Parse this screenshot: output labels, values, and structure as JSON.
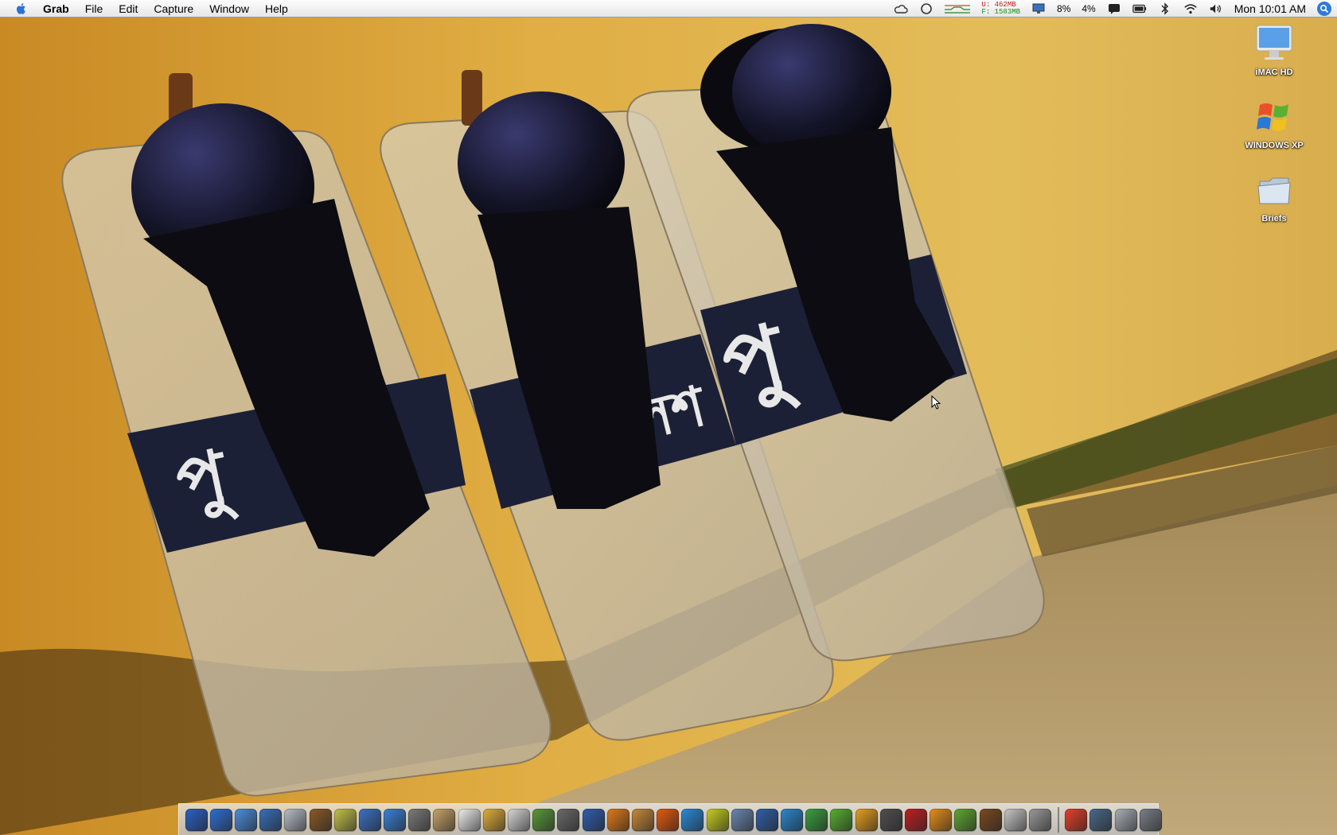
{
  "menubar": {
    "app_name": "Grab",
    "menus": [
      "File",
      "Edit",
      "Capture",
      "Window",
      "Help"
    ],
    "status": {
      "memory_used": "U: 462MB",
      "memory_free": "F: 1583MB",
      "cpu_percent_1": "8%",
      "cpu_percent_2": "4%",
      "clock": "Mon 10:01 AM"
    }
  },
  "desktop_icons": [
    {
      "label": "iMAC HD",
      "icon": "hard-drive-icon"
    },
    {
      "label": "WINDOWS XP",
      "icon": "windows-logo-icon"
    },
    {
      "label": "Briefs",
      "icon": "folder-icon"
    }
  ],
  "wallpaper": {
    "wall_color": "#d9a83c",
    "floor_color": "#b8a070",
    "shield_text_1": "পু",
    "shield_text_2": "লিশ",
    "shield_text_3": "পু"
  },
  "dock": {
    "apps_left": [
      "#2b62c7",
      "#2f6fd6",
      "#4a8fe0",
      "#3a70b8",
      "#b9c0c9",
      "#8a5a2a",
      "#c6c24a",
      "#3b72c5",
      "#3a82d8",
      "#7b7b7b",
      "#c9a56a",
      "#f0f0f0",
      "#e1b03a",
      "#d8d8d8",
      "#5a9a3a",
      "#6a6a6a",
      "#2f5fb0",
      "#e07a1a",
      "#c88a3a",
      "#e65a10",
      "#2a8ad8",
      "#c8d020",
      "#6a88b0",
      "#3060a8",
      "#2a88d0",
      "#3aa040",
      "#58b030",
      "#e8a020",
      "#505050",
      "#c02020",
      "#e8901a",
      "#60a830",
      "#7a4a20",
      "#c8c8c8",
      "#9a9a9a"
    ],
    "apps_right": [
      "#e8402a",
      "#4a6a8a",
      "#a8b0b8",
      "#7a8088"
    ]
  }
}
